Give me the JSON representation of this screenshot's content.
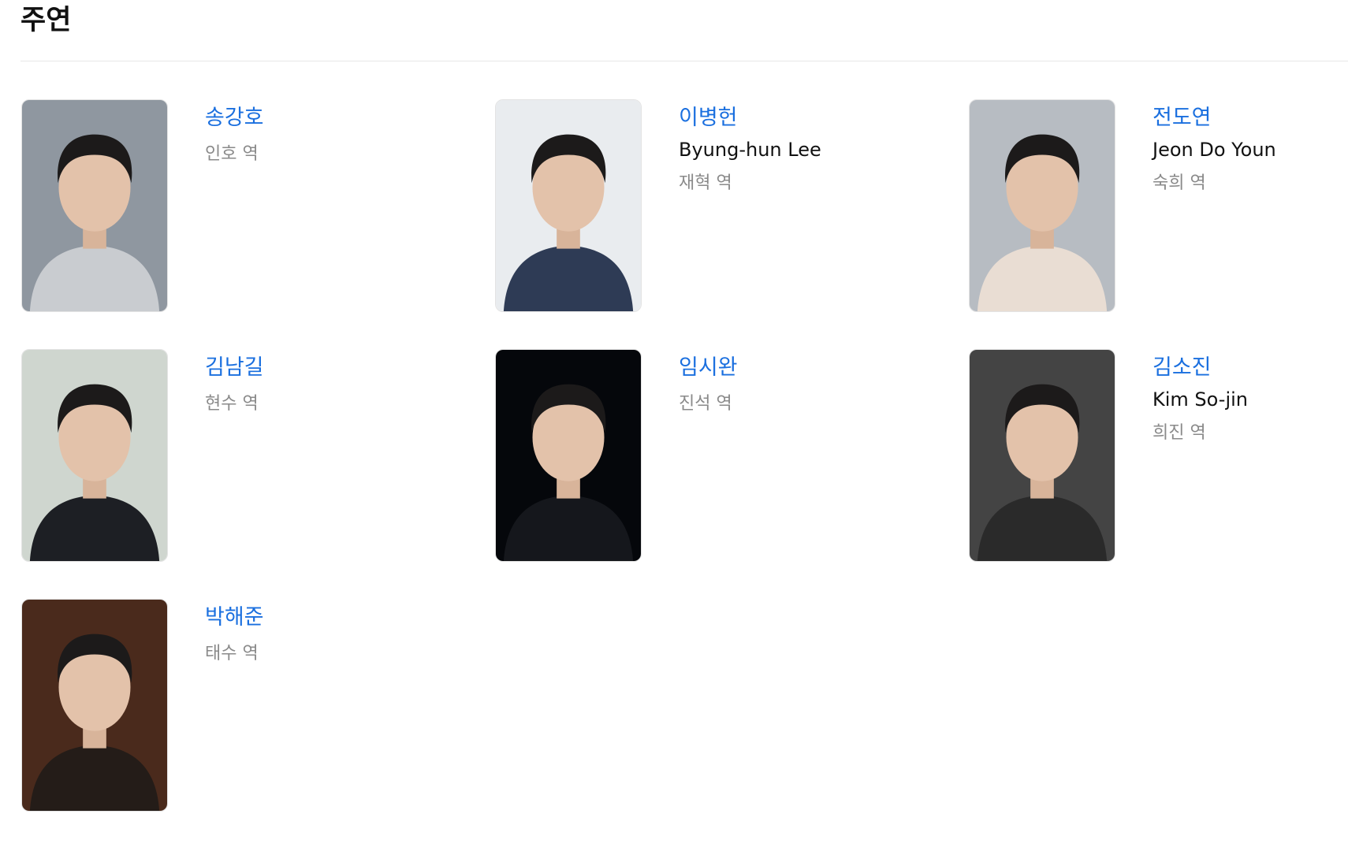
{
  "section": {
    "title": "주연"
  },
  "cast": [
    {
      "name": "송강호",
      "english_name": "",
      "role": "인호 역",
      "photo_tone": "#c9ccd0",
      "photo_bg": "#8f97a0"
    },
    {
      "name": "이병헌",
      "english_name": "Byung-hun Lee",
      "role": "재혁 역",
      "photo_tone": "#2e3b55",
      "photo_bg": "#e9ecef"
    },
    {
      "name": "전도연",
      "english_name": "Jeon Do Youn",
      "role": "숙희 역",
      "photo_tone": "#e9ddd3",
      "photo_bg": "#b7bcc2"
    },
    {
      "name": "김남길",
      "english_name": "",
      "role": "현수 역",
      "photo_tone": "#1d1f24",
      "photo_bg": "#cfd6cf"
    },
    {
      "name": "임시완",
      "english_name": "",
      "role": "진석 역",
      "photo_tone": "#15171c",
      "photo_bg": "#05070b"
    },
    {
      "name": "김소진",
      "english_name": "Kim So-jin",
      "role": "희진 역",
      "photo_tone": "#2a2a2a",
      "photo_bg": "#444444"
    },
    {
      "name": "박해준",
      "english_name": "",
      "role": "태수 역",
      "photo_tone": "#241c18",
      "photo_bg": "#4a2a1c"
    }
  ]
}
